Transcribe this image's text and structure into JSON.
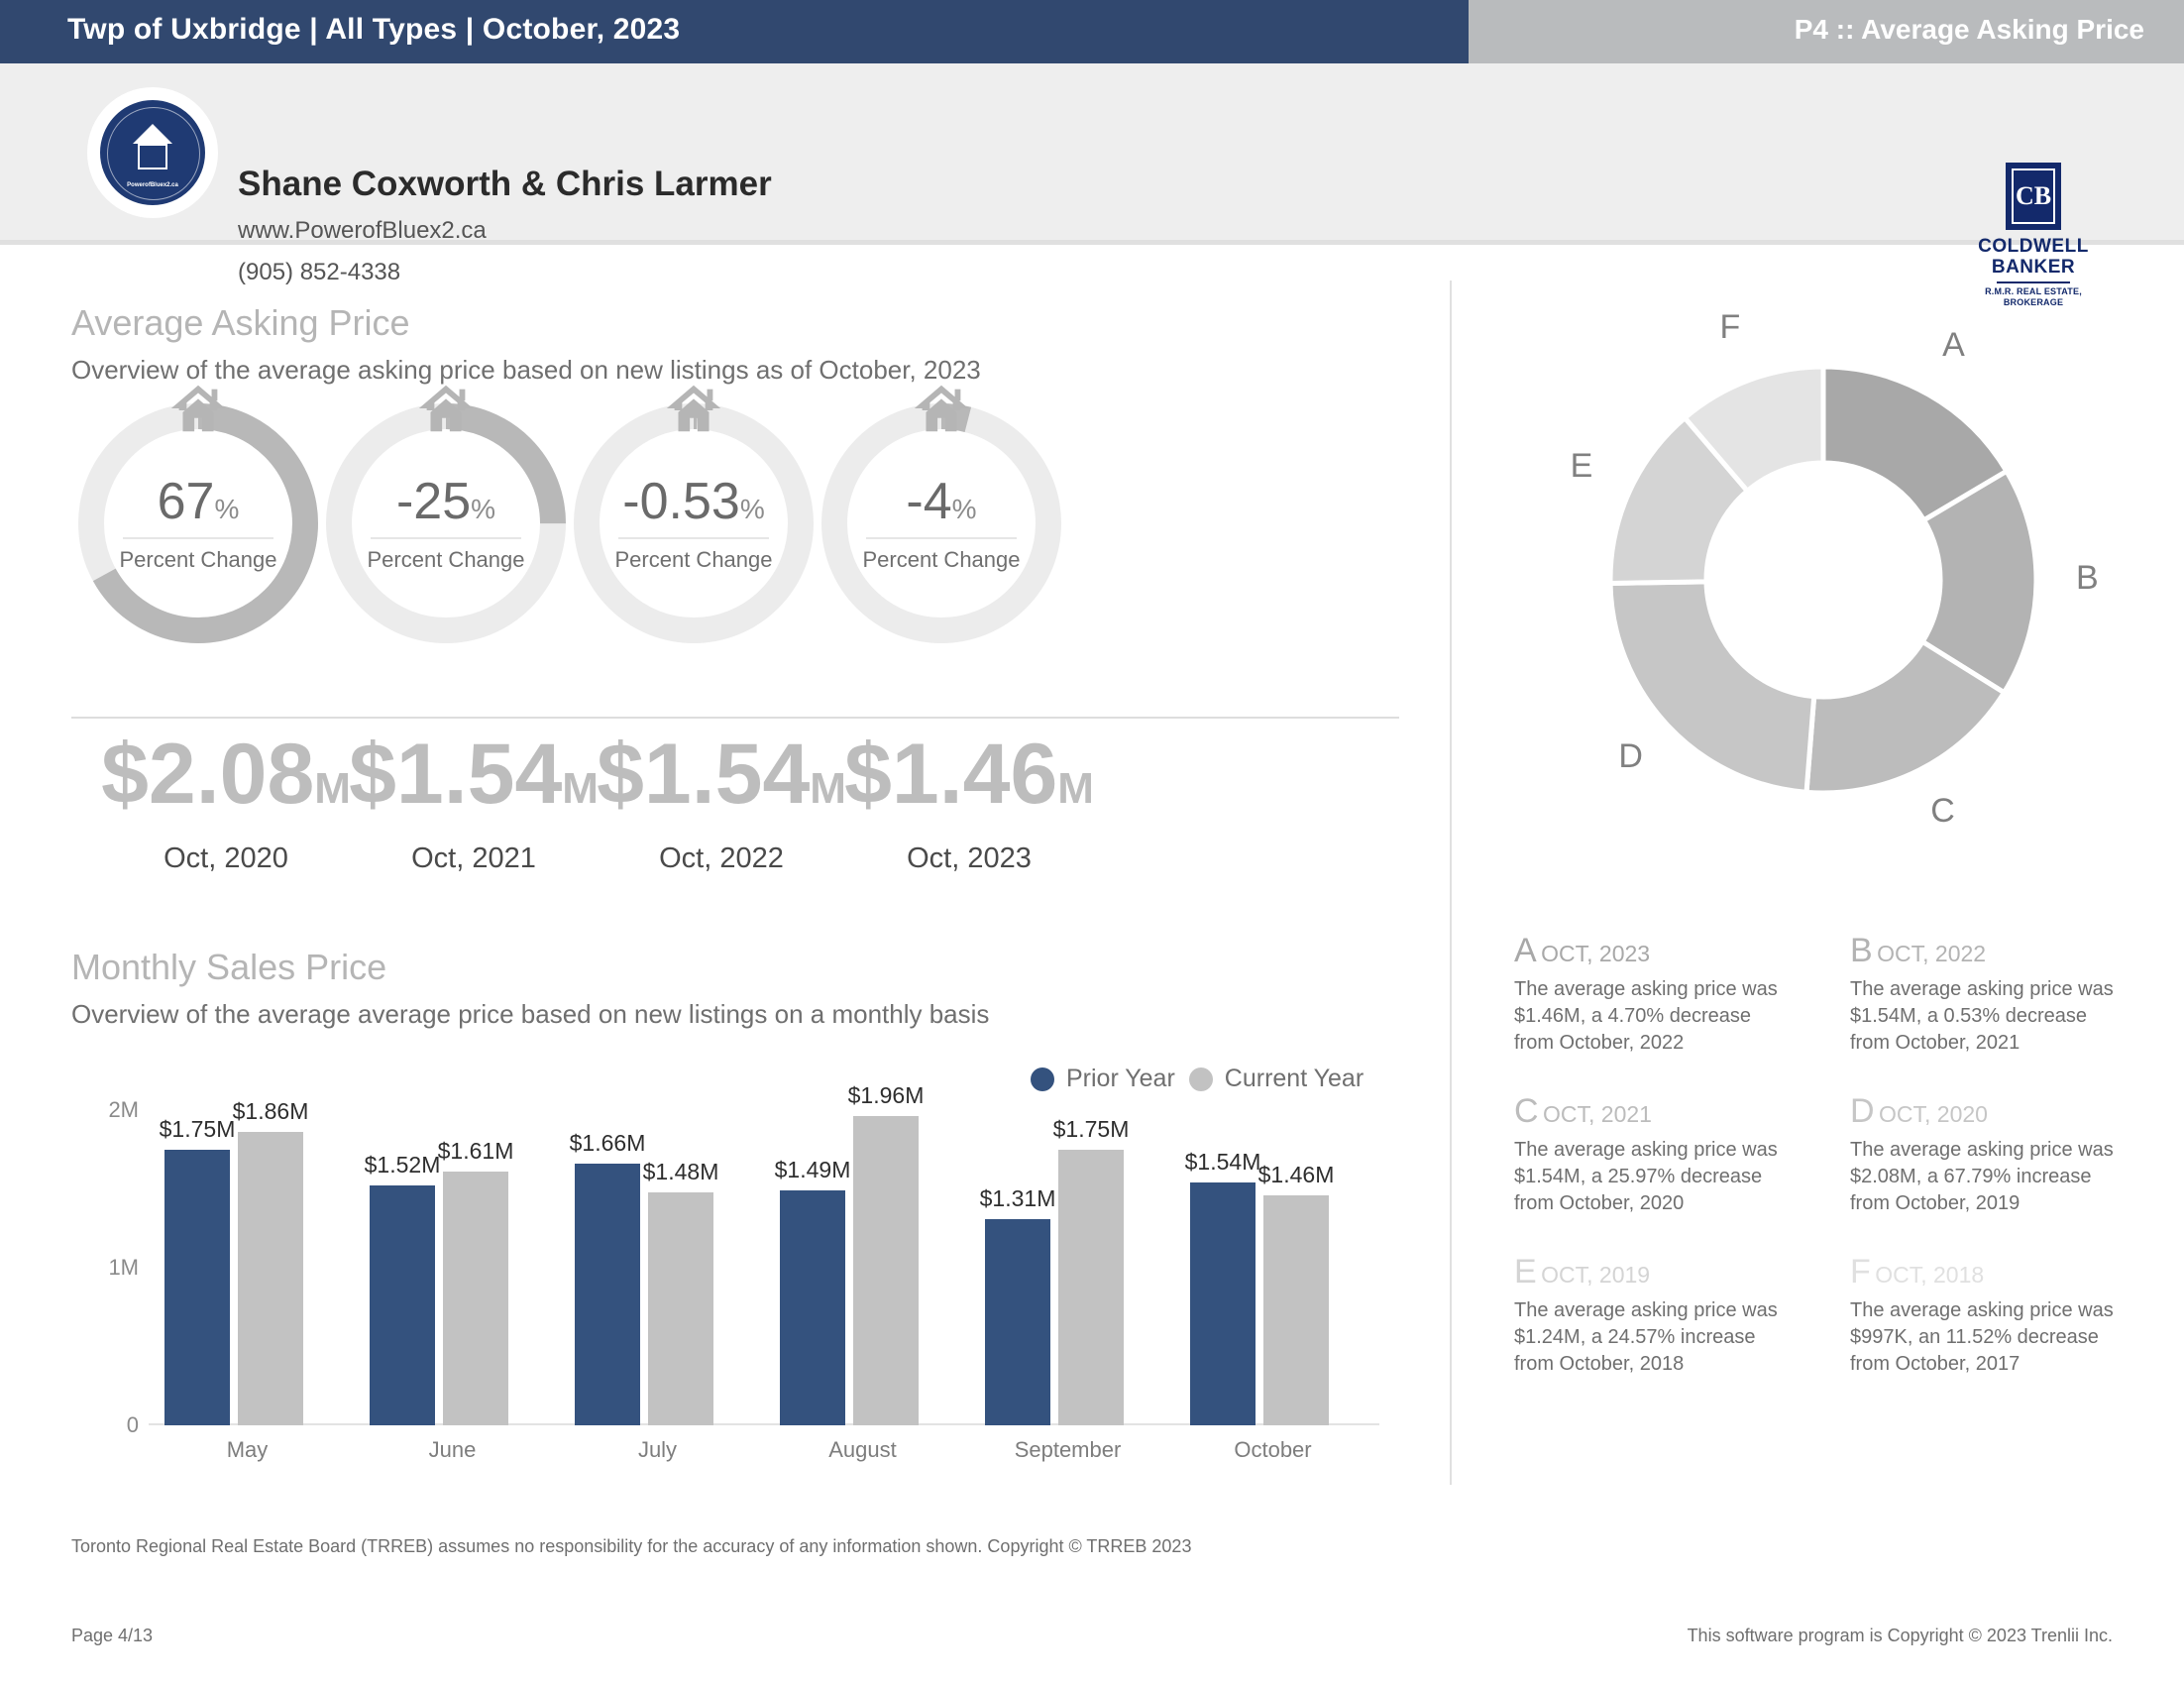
{
  "header": {
    "title": "Twp of Uxbridge | All Types | October, 2023",
    "page_label": "P4 :: Average Asking Price",
    "bar_color": "#31486f",
    "accent_color": "#b9bbbd"
  },
  "agent": {
    "name": "Shane Coxworth & Chris Larmer",
    "website": "www.PowerofBluex2.ca",
    "phone": "(905) 852-4338",
    "logo_text": "PowerofBluex2.ca"
  },
  "brokerage": {
    "mark": "CB",
    "line1": "COLDWELL",
    "line2": "BANKER",
    "sub1": "R.M.R. REAL ESTATE,",
    "sub2": "BROKERAGE"
  },
  "section_price": {
    "heading": "Average Asking Price",
    "subheading": "Overview of the average asking price based on new listings as of October, 2023",
    "gauges": [
      {
        "value": "67",
        "pct_symbol": "%",
        "caption": "Percent Change",
        "fill_fraction": 0.67
      },
      {
        "value": "-25",
        "pct_symbol": "%",
        "caption": "Percent Change",
        "fill_fraction": 0.25
      },
      {
        "value": "-0.53",
        "pct_symbol": "%",
        "caption": "Percent Change",
        "fill_fraction": 0.0053
      },
      {
        "value": "-4",
        "pct_symbol": "%",
        "caption": "Percent Change",
        "fill_fraction": 0.04
      }
    ],
    "prices": [
      {
        "amount": "$2.08",
        "unit": "M",
        "label": "Oct, 2020"
      },
      {
        "amount": "$1.54",
        "unit": "M",
        "label": "Oct, 2021"
      },
      {
        "amount": "$1.54",
        "unit": "M",
        "label": "Oct, 2022"
      },
      {
        "amount": "$1.46",
        "unit": "M",
        "label": "Oct, 2023"
      }
    ]
  },
  "section_monthly": {
    "heading": "Monthly Sales Price",
    "subheading": "Overview of the average average price based on new listings on a monthly basis",
    "legend": [
      {
        "label": "Prior Year",
        "color": "#34527e"
      },
      {
        "label": "Current Year",
        "color": "#c2c2c2"
      }
    ]
  },
  "chart_data": {
    "type": "bar",
    "title": "Monthly Sales Price",
    "categories": [
      "May",
      "June",
      "July",
      "August",
      "September",
      "October"
    ],
    "series": [
      {
        "name": "Prior Year",
        "color": "#34527e",
        "values": [
          1750000,
          1520000,
          1660000,
          1490000,
          1310000,
          1540000
        ],
        "labels": [
          "$1.75M",
          "$1.52M",
          "$1.66M",
          "$1.49M",
          "$1.31M",
          "$1.54M"
        ]
      },
      {
        "name": "Current Year",
        "color": "#c2c2c2",
        "values": [
          1860000,
          1610000,
          1480000,
          1960000,
          1750000,
          1460000
        ],
        "labels": [
          "$1.86M",
          "$1.61M",
          "$1.48M",
          "$1.96M",
          "$1.75M",
          "$1.46M"
        ]
      }
    ],
    "ylim": [
      0,
      2000000
    ],
    "yticks": [
      0,
      1000000,
      2000000
    ],
    "ytick_labels": [
      "0",
      "1M",
      "2M"
    ],
    "xlabel": "",
    "ylabel": "",
    "grid": false,
    "legend_position": "top-right"
  },
  "donut": {
    "type": "pie",
    "labels": [
      "A",
      "B",
      "C",
      "D",
      "E",
      "F"
    ],
    "values": [
      1.46,
      1.54,
      1.54,
      2.08,
      1.24,
      0.997
    ],
    "colors": [
      "#a8a8a8",
      "#b3b3b3",
      "#bcbcbc",
      "#c6c6c6",
      "#d4d4d4",
      "#e4e4e4"
    ]
  },
  "donut_legend": [
    {
      "letter": "A",
      "when": "OCT, 2023",
      "letter_color": "#a8a8a8",
      "line1": "The average asking price was",
      "line2": "$1.46M, a 4.70% decrease",
      "line3": "from October, 2022"
    },
    {
      "letter": "B",
      "when": "OCT, 2022",
      "letter_color": "#b3b3b3",
      "line1": "The average asking price was",
      "line2": "$1.54M, a 0.53% decrease",
      "line3": "from October, 2021"
    },
    {
      "letter": "C",
      "when": "OCT, 2021",
      "letter_color": "#bcbcbc",
      "line1": "The average asking price was",
      "line2": "$1.54M, a 25.97% decrease",
      "line3": "from October, 2020"
    },
    {
      "letter": "D",
      "when": "OCT, 2020",
      "letter_color": "#c6c6c6",
      "line1": "The average asking price was",
      "line2": "$2.08M, a 67.79% increase",
      "line3": "from October, 2019"
    },
    {
      "letter": "E",
      "when": "OCT, 2019",
      "letter_color": "#d4d4d4",
      "line1": "The average asking price was",
      "line2": "$1.24M, a 24.57% increase",
      "line3": "from October, 2018"
    },
    {
      "letter": "F",
      "when": "OCT, 2018",
      "letter_color": "#e0e0e0",
      "line1": "The average asking price was",
      "line2": "$997K, an 11.52% decrease",
      "line3": "from October, 2017"
    }
  ],
  "footer": {
    "disclaimer": "Toronto Regional Real Estate Board (TRREB) assumes no responsibility for the accuracy of any information shown. Copyright © TRREB 2023",
    "page": "Page 4/13",
    "copyright": "This software program is Copyright © 2023 Trenlii Inc."
  }
}
